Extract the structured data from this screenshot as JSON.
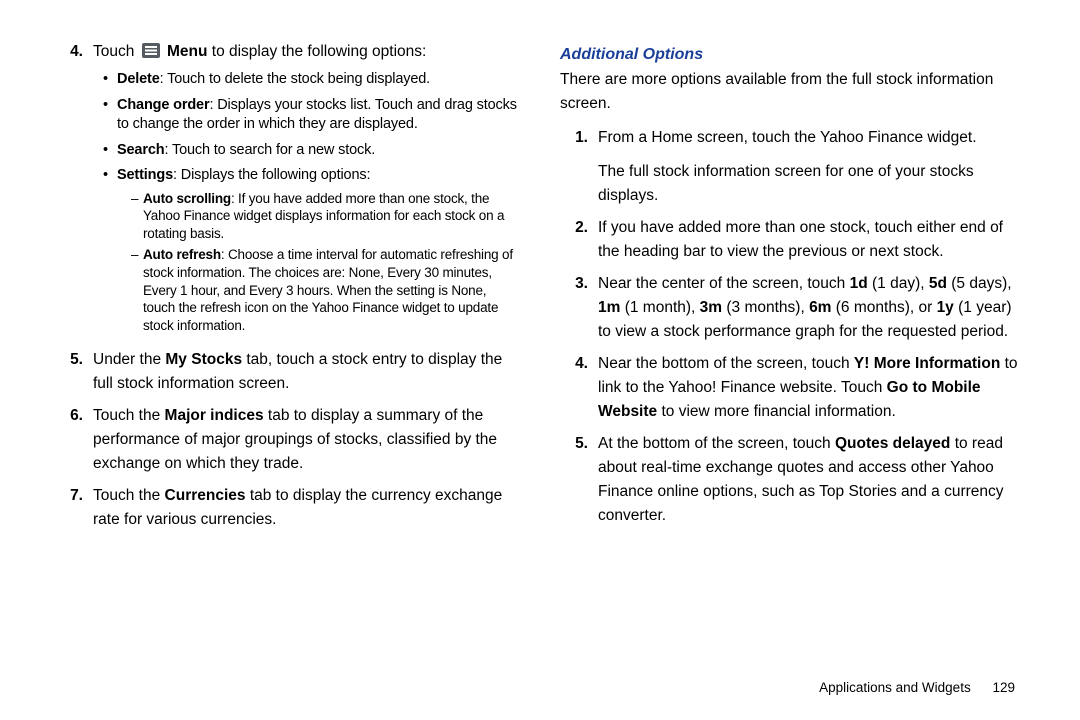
{
  "left": {
    "items": [
      {
        "num": "4.",
        "pre": "Touch ",
        "iconLabel": "Menu",
        "post": " to display the following options:",
        "bullets": [
          {
            "label": "Delete",
            "text": ": Touch to delete the stock being displayed."
          },
          {
            "label": "Change order",
            "text": ": Displays your stocks list. Touch and drag stocks to change the order in which they are displayed."
          },
          {
            "label": "Search",
            "text": ": Touch to search for a new stock."
          },
          {
            "label": "Settings",
            "text": ": Displays the following options:",
            "dashes": [
              {
                "label": "Auto scrolling",
                "text": ": If you have added more than one stock, the Yahoo Finance widget displays information for each stock on a rotating basis."
              },
              {
                "label": "Auto refresh",
                "text": ": Choose a time interval for automatic refreshing of stock information. The choices are: None, Every 30 minutes, Every 1 hour, and Every 3 hours. When the setting is None, touch the refresh icon on the Yahoo Finance widget to update stock information."
              }
            ]
          }
        ]
      },
      {
        "num": "5.",
        "segments": [
          {
            "t": "Under the "
          },
          {
            "t": "My Stocks",
            "b": true
          },
          {
            "t": " tab, touch a stock entry to display the full stock information screen."
          }
        ]
      },
      {
        "num": "6.",
        "segments": [
          {
            "t": "Touch the "
          },
          {
            "t": "Major indices",
            "b": true
          },
          {
            "t": " tab to display a summary of the performance of major groupings of stocks, classified by the exchange on which they trade."
          }
        ]
      },
      {
        "num": "7.",
        "segments": [
          {
            "t": "Touch the "
          },
          {
            "t": "Currencies",
            "b": true
          },
          {
            "t": " tab to display the currency exchange rate for various currencies."
          }
        ]
      }
    ]
  },
  "right": {
    "heading": "Additional Options",
    "intro": "There are more options available from the full stock information screen.",
    "items": [
      {
        "num": "1.",
        "segments": [
          {
            "t": "From a Home screen, touch the Yahoo Finance widget."
          }
        ],
        "after": "The full stock information screen for one of your stocks displays."
      },
      {
        "num": "2.",
        "segments": [
          {
            "t": "If you have added more than one stock, touch either end of the heading bar to view the previous or next stock."
          }
        ]
      },
      {
        "num": "3.",
        "segments": [
          {
            "t": "Near the center of the screen, touch "
          },
          {
            "t": "1d",
            "b": true
          },
          {
            "t": " (1 day), "
          },
          {
            "t": "5d",
            "b": true
          },
          {
            "t": " (5 days), "
          },
          {
            "t": "1m",
            "b": true
          },
          {
            "t": " (1 month), "
          },
          {
            "t": "3m",
            "b": true
          },
          {
            "t": " (3 months), "
          },
          {
            "t": "6m",
            "b": true
          },
          {
            "t": " (6 months), or "
          },
          {
            "t": "1y",
            "b": true
          },
          {
            "t": " (1 year) to view a stock performance graph for the requested period."
          }
        ]
      },
      {
        "num": "4.",
        "segments": [
          {
            "t": "Near the bottom of the screen, touch "
          },
          {
            "t": "Y! More Information",
            "b": true
          },
          {
            "t": " to link to the Yahoo! Finance website. Touch "
          },
          {
            "t": "Go to Mobile Website",
            "b": true
          },
          {
            "t": " to view more financial information."
          }
        ]
      },
      {
        "num": "5.",
        "segments": [
          {
            "t": "At the bottom of the screen, touch "
          },
          {
            "t": "Quotes delayed",
            "b": true
          },
          {
            "t": " to read about real-time exchange quotes and access other Yahoo Finance online options, such as Top Stories and a currency converter."
          }
        ]
      }
    ]
  },
  "footer": {
    "section": "Applications and Widgets",
    "page": "129"
  }
}
